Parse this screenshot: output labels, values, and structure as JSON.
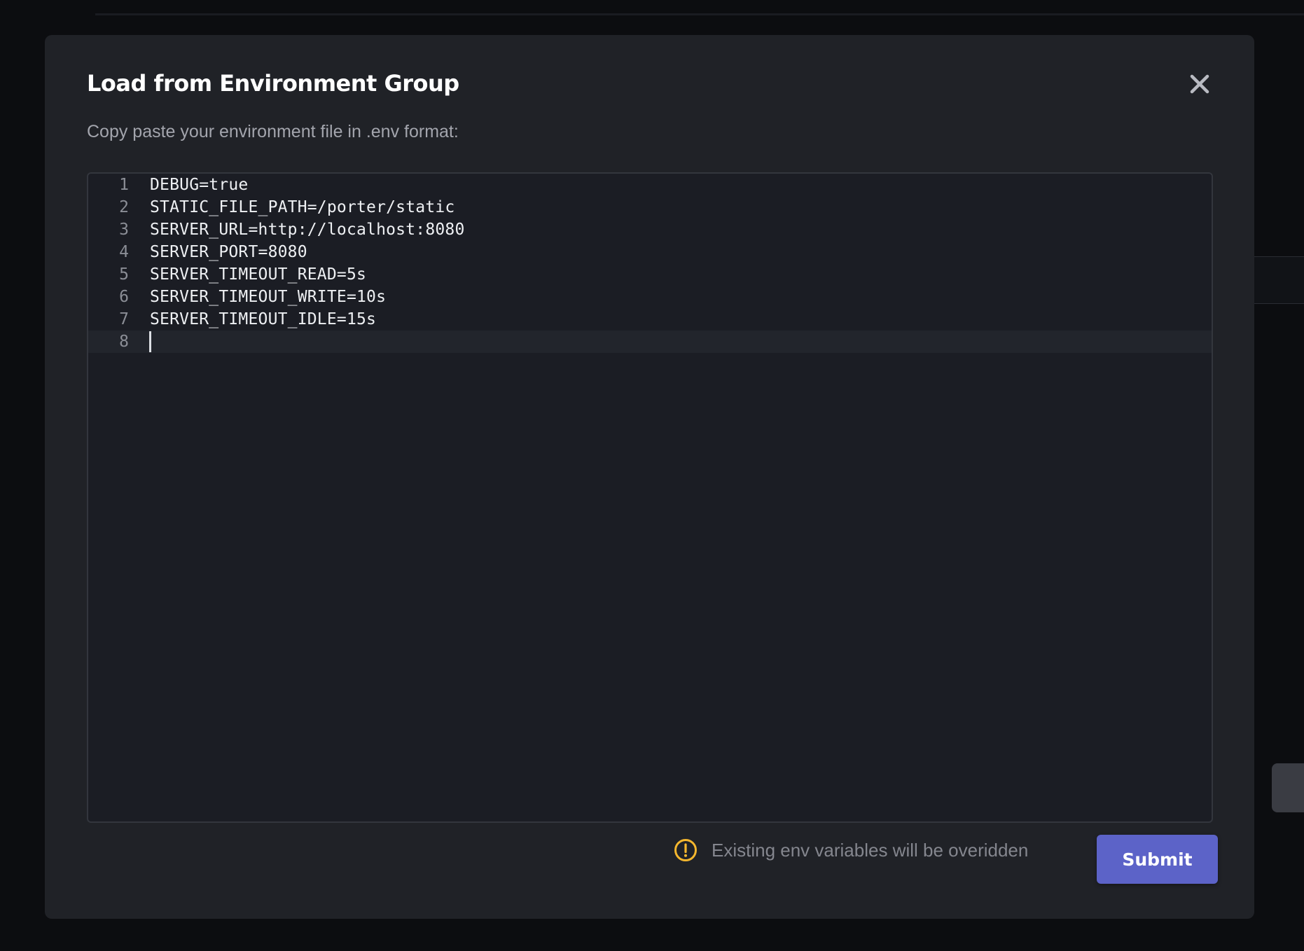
{
  "modal": {
    "title": "Load from Environment Group",
    "subtitle": "Copy paste your environment file in .env format:",
    "close_icon": "close-icon"
  },
  "editor": {
    "lines": [
      {
        "num": "1",
        "text": "DEBUG=true"
      },
      {
        "num": "2",
        "text": "STATIC_FILE_PATH=/porter/static"
      },
      {
        "num": "3",
        "text": "SERVER_URL=http://localhost:8080"
      },
      {
        "num": "4",
        "text": "SERVER_PORT=8080"
      },
      {
        "num": "5",
        "text": "SERVER_TIMEOUT_READ=5s"
      },
      {
        "num": "6",
        "text": "SERVER_TIMEOUT_WRITE=10s"
      },
      {
        "num": "7",
        "text": "SERVER_TIMEOUT_IDLE=15s"
      },
      {
        "num": "8",
        "text": ""
      }
    ],
    "active_line": "8"
  },
  "footer": {
    "warning_icon": "warning-icon",
    "warning_text": "Existing env variables will be overidden",
    "submit_label": "Submit"
  },
  "colors": {
    "accent": "#5c63c8",
    "warning": "#f5b72e",
    "modal_bg": "#202227",
    "editor_bg": "#1b1d24"
  }
}
